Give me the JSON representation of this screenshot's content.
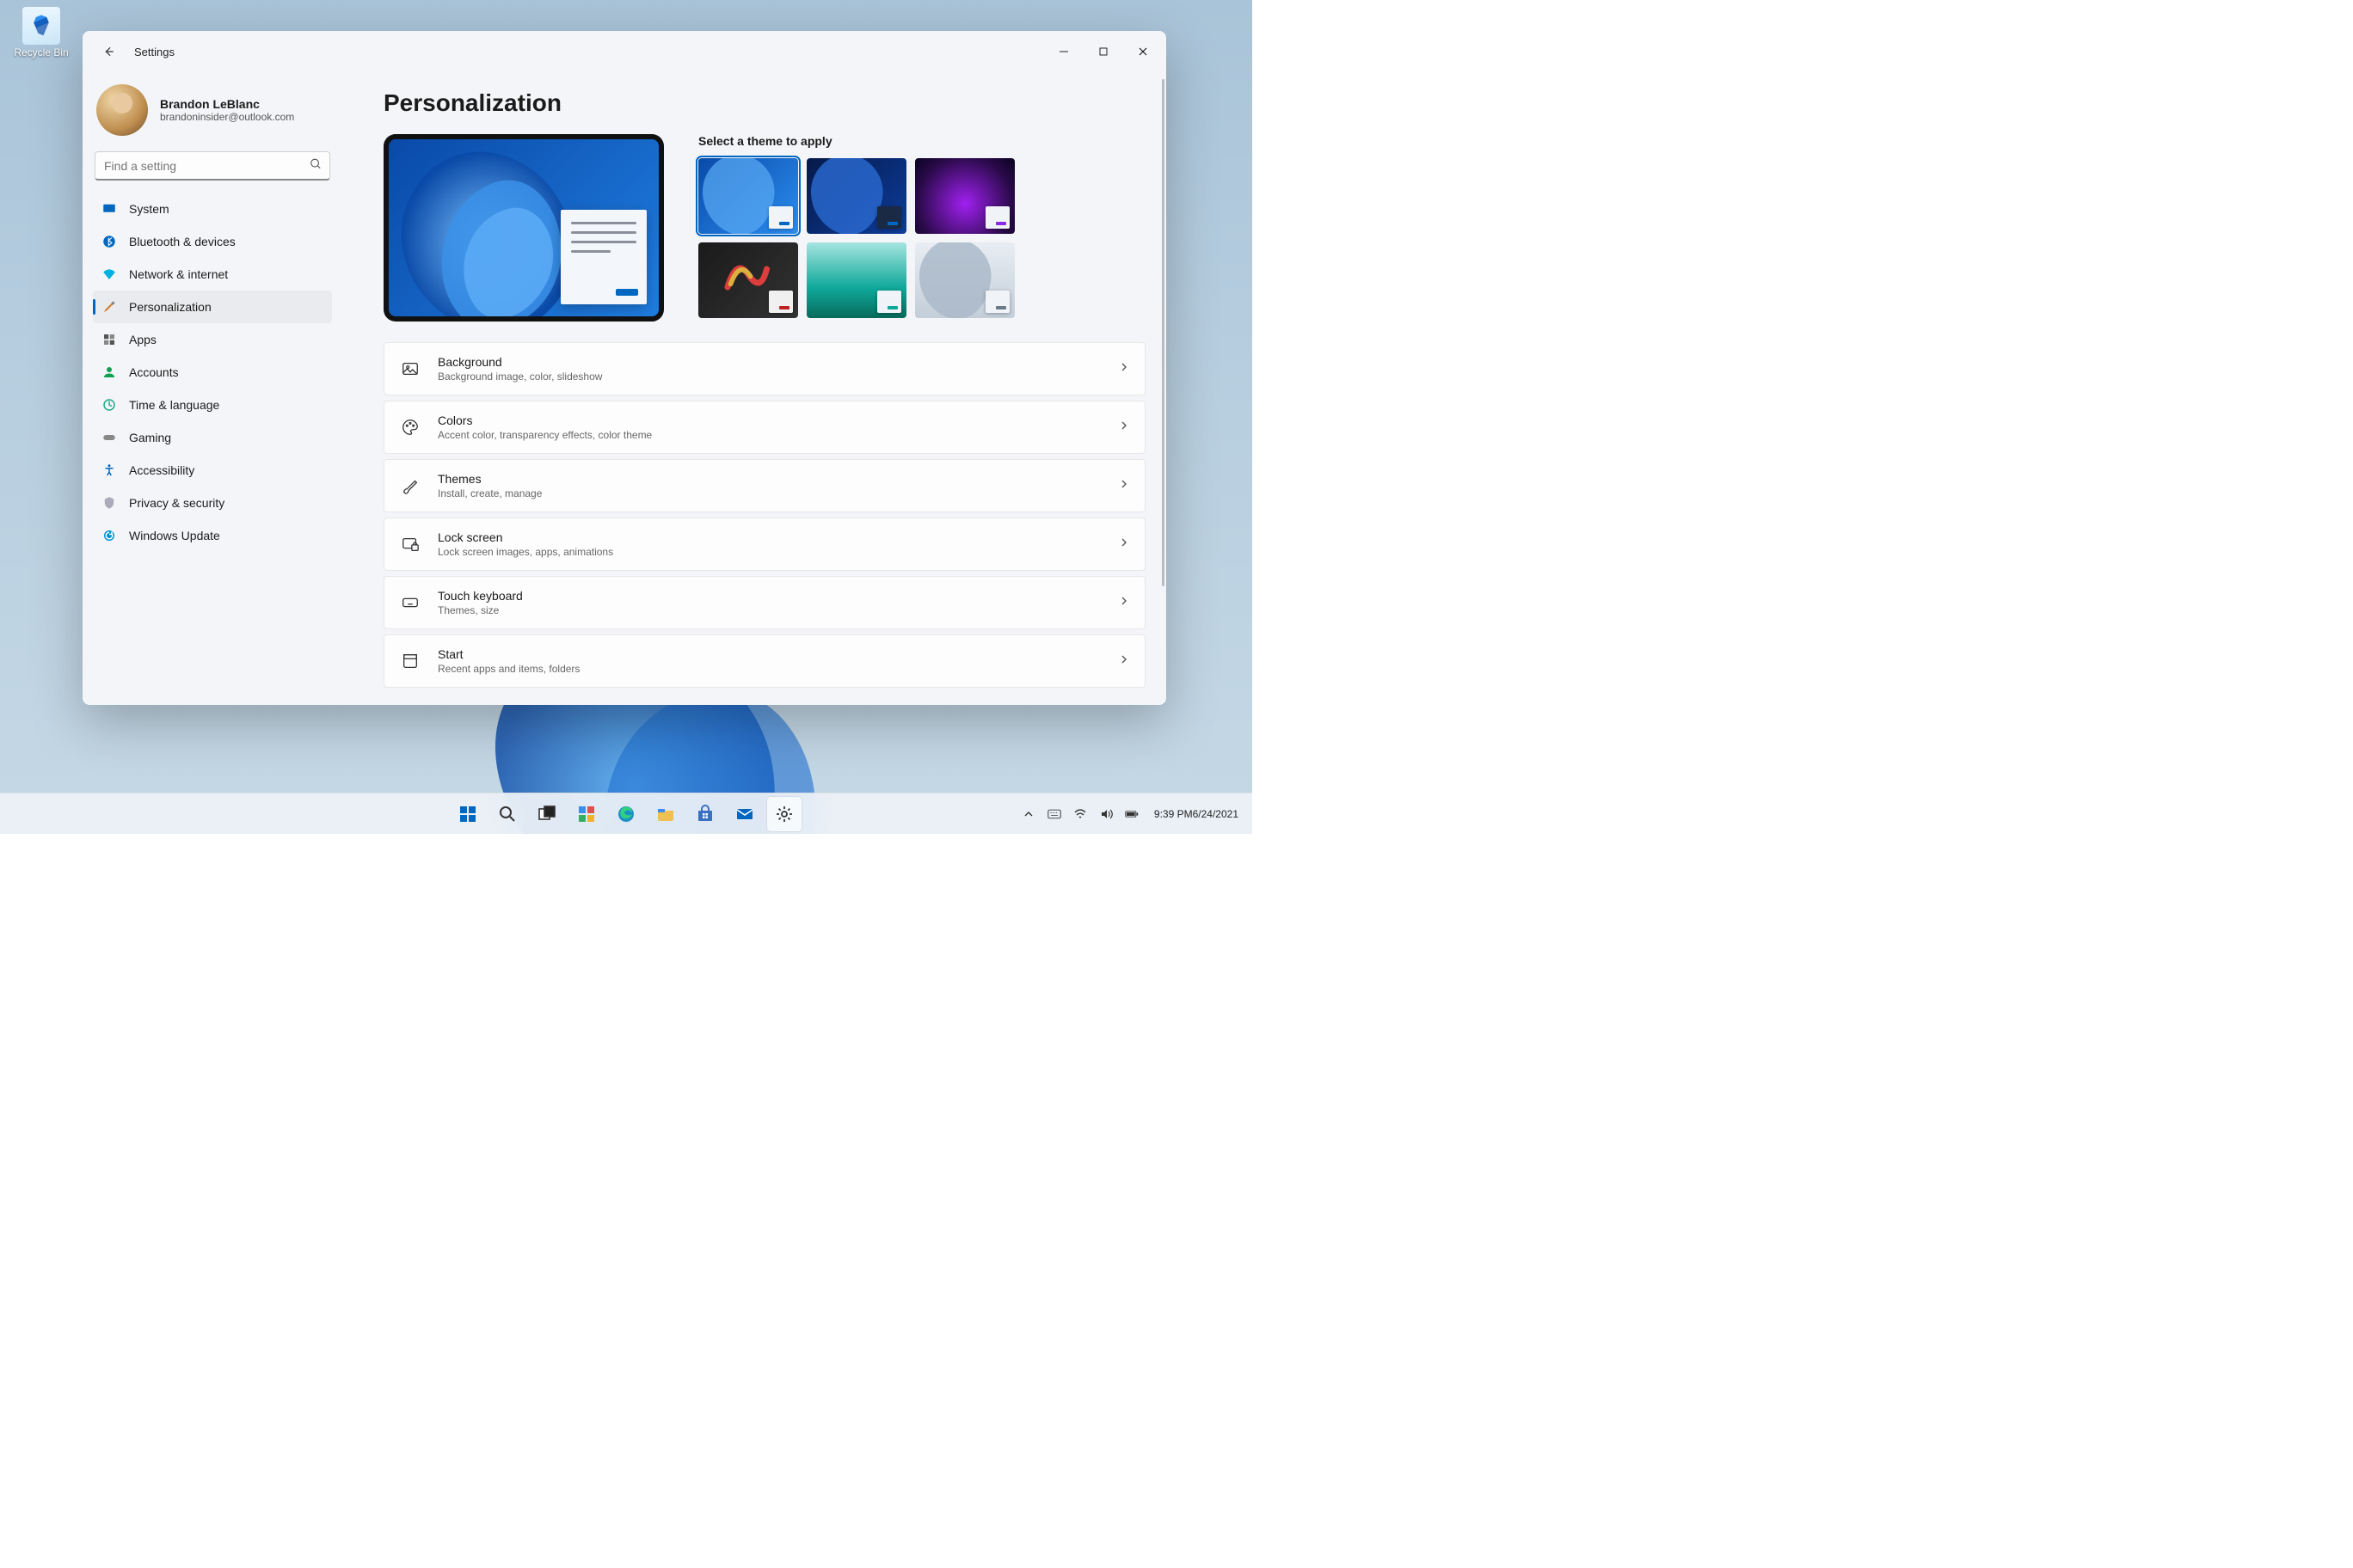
{
  "desktop": {
    "recycle_bin_label": "Recycle Bin"
  },
  "window": {
    "title": "Settings"
  },
  "profile": {
    "name": "Brandon LeBlanc",
    "email": "brandoninsider@outlook.com"
  },
  "search": {
    "placeholder": "Find a setting"
  },
  "sidebar": {
    "items": [
      {
        "label": "System"
      },
      {
        "label": "Bluetooth & devices"
      },
      {
        "label": "Network & internet"
      },
      {
        "label": "Personalization"
      },
      {
        "label": "Apps"
      },
      {
        "label": "Accounts"
      },
      {
        "label": "Time & language"
      },
      {
        "label": "Gaming"
      },
      {
        "label": "Accessibility"
      },
      {
        "label": "Privacy & security"
      },
      {
        "label": "Windows Update"
      }
    ],
    "active_index": 3
  },
  "page": {
    "title": "Personalization",
    "theme_heading": "Select a theme to apply"
  },
  "cards": [
    {
      "title": "Background",
      "sub": "Background image, color, slideshow"
    },
    {
      "title": "Colors",
      "sub": "Accent color, transparency effects, color theme"
    },
    {
      "title": "Themes",
      "sub": "Install, create, manage"
    },
    {
      "title": "Lock screen",
      "sub": "Lock screen images, apps, animations"
    },
    {
      "title": "Touch keyboard",
      "sub": "Themes, size"
    },
    {
      "title": "Start",
      "sub": "Recent apps and items, folders"
    }
  ],
  "taskbar": {
    "time": "9:39 PM",
    "date": "6/24/2021"
  }
}
